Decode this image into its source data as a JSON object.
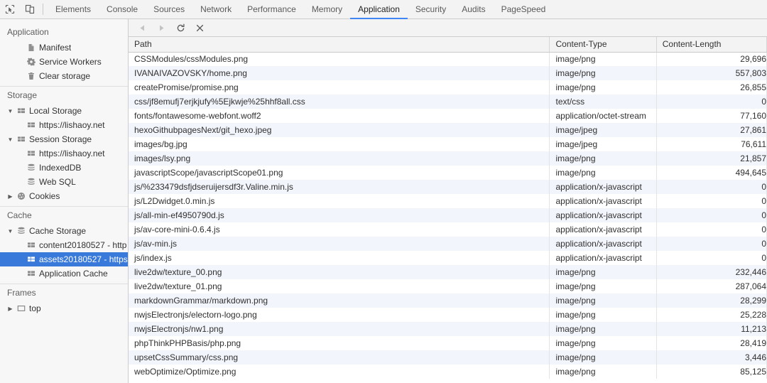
{
  "toolbar": {
    "inspect_icon": "inspect-cursor-icon",
    "device_icon": "device-toolbar-icon",
    "tabs": [
      {
        "label": "Elements",
        "active": false
      },
      {
        "label": "Console",
        "active": false
      },
      {
        "label": "Sources",
        "active": false
      },
      {
        "label": "Network",
        "active": false
      },
      {
        "label": "Performance",
        "active": false
      },
      {
        "label": "Memory",
        "active": false
      },
      {
        "label": "Application",
        "active": true
      },
      {
        "label": "Security",
        "active": false
      },
      {
        "label": "Audits",
        "active": false
      },
      {
        "label": "PageSpeed",
        "active": false
      }
    ],
    "active_tab": "Application",
    "accent_color": "#4285f4"
  },
  "sidebar": {
    "selection_color": "#3879d9",
    "sections": [
      {
        "title": "Application",
        "items": [
          {
            "label": "Manifest",
            "icon": "document-icon",
            "indent": 1,
            "twisty": "none",
            "selected": false
          },
          {
            "label": "Service Workers",
            "icon": "gear-icon",
            "indent": 1,
            "twisty": "none",
            "selected": false
          },
          {
            "label": "Clear storage",
            "icon": "trash-icon",
            "indent": 1,
            "twisty": "none",
            "selected": false
          }
        ]
      },
      {
        "title": "Storage",
        "items": [
          {
            "label": "Local Storage",
            "icon": "table-icon",
            "indent": 0,
            "twisty": "expanded",
            "selected": false
          },
          {
            "label": "https://lishaoy.net",
            "icon": "table-icon",
            "indent": 1,
            "twisty": "none",
            "selected": false
          },
          {
            "label": "Session Storage",
            "icon": "table-icon",
            "indent": 0,
            "twisty": "expanded",
            "selected": false
          },
          {
            "label": "https://lishaoy.net",
            "icon": "table-icon",
            "indent": 1,
            "twisty": "none",
            "selected": false
          },
          {
            "label": "IndexedDB",
            "icon": "database-icon",
            "indent": 1,
            "twisty": "none",
            "selected": false
          },
          {
            "label": "Web SQL",
            "icon": "database-icon",
            "indent": 1,
            "twisty": "none",
            "selected": false
          },
          {
            "label": "Cookies",
            "icon": "cookie-icon",
            "indent": 0,
            "twisty": "collapsed",
            "selected": false
          }
        ]
      },
      {
        "title": "Cache",
        "items": [
          {
            "label": "Cache Storage",
            "icon": "database-icon",
            "indent": 0,
            "twisty": "expanded",
            "selected": false
          },
          {
            "label": "content20180527 - http",
            "icon": "table-icon",
            "indent": 1,
            "twisty": "none",
            "selected": false
          },
          {
            "label": "assets20180527 - https",
            "icon": "table-icon",
            "indent": 1,
            "twisty": "none",
            "selected": true
          },
          {
            "label": "Application Cache",
            "icon": "table-icon",
            "indent": 1,
            "twisty": "none",
            "selected": false
          }
        ]
      },
      {
        "title": "Frames",
        "items": [
          {
            "label": "top",
            "icon": "frame-icon",
            "indent": 0,
            "twisty": "collapsed",
            "selected": false
          }
        ]
      }
    ]
  },
  "content_toolbar": {
    "buttons": [
      {
        "name": "back-button",
        "icon": "triangle-left-icon",
        "disabled": true
      },
      {
        "name": "forward-button",
        "icon": "triangle-right-icon",
        "disabled": true
      },
      {
        "name": "refresh-button",
        "icon": "refresh-icon",
        "disabled": false
      },
      {
        "name": "delete-button",
        "icon": "close-x-icon",
        "disabled": false
      }
    ]
  },
  "grid": {
    "columns": [
      "Path",
      "Content-Type",
      "Content-Length"
    ],
    "rows": [
      {
        "path": "CSSModules/cssModules.png",
        "type": "image/png",
        "length": "29,696"
      },
      {
        "path": "IVANAIVAZOVSKY/home.png",
        "type": "image/png",
        "length": "557,803"
      },
      {
        "path": "createPromise/promise.png",
        "type": "image/png",
        "length": "26,855"
      },
      {
        "path": "css/jf8emufj7erjkjufy%5Ejkwje%25hhf8all.css",
        "type": "text/css",
        "length": "0"
      },
      {
        "path": "fonts/fontawesome-webfont.woff2",
        "type": "application/octet-stream",
        "length": "77,160"
      },
      {
        "path": "hexoGithubpagesNext/git_hexo.jpeg",
        "type": "image/jpeg",
        "length": "27,861"
      },
      {
        "path": "images/bg.jpg",
        "type": "image/jpeg",
        "length": "76,611"
      },
      {
        "path": "images/lsy.png",
        "type": "image/png",
        "length": "21,857"
      },
      {
        "path": "javascriptScope/javascriptScope01.png",
        "type": "image/png",
        "length": "494,645"
      },
      {
        "path": "js/%233479dsfjdseruijersdf3r.Valine.min.js",
        "type": "application/x-javascript",
        "length": "0"
      },
      {
        "path": "js/L2Dwidget.0.min.js",
        "type": "application/x-javascript",
        "length": "0"
      },
      {
        "path": "js/all-min-ef4950790d.js",
        "type": "application/x-javascript",
        "length": "0"
      },
      {
        "path": "js/av-core-mini-0.6.4.js",
        "type": "application/x-javascript",
        "length": "0"
      },
      {
        "path": "js/av-min.js",
        "type": "application/x-javascript",
        "length": "0"
      },
      {
        "path": "js/index.js",
        "type": "application/x-javascript",
        "length": "0"
      },
      {
        "path": "live2dw/texture_00.png",
        "type": "image/png",
        "length": "232,446"
      },
      {
        "path": "live2dw/texture_01.png",
        "type": "image/png",
        "length": "287,064"
      },
      {
        "path": "markdownGrammar/markdown.png",
        "type": "image/png",
        "length": "28,299"
      },
      {
        "path": "nwjsElectronjs/electorn-logo.png",
        "type": "image/png",
        "length": "25,228"
      },
      {
        "path": "nwjsElectronjs/nw1.png",
        "type": "image/png",
        "length": "11,213"
      },
      {
        "path": "phpThinkPHPBasis/php.png",
        "type": "image/png",
        "length": "28,419"
      },
      {
        "path": "upsetCssSummary/css.png",
        "type": "image/png",
        "length": "3,446"
      },
      {
        "path": "webOptimize/Optimize.png",
        "type": "image/png",
        "length": "85,125"
      }
    ]
  }
}
